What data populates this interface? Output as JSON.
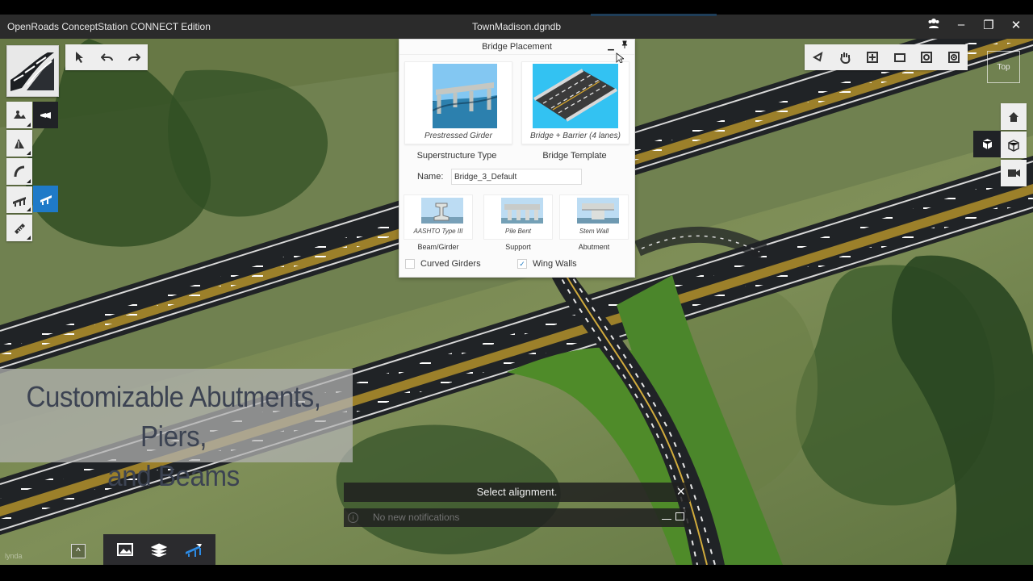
{
  "window": {
    "app_title": "OpenRoads ConceptStation CONNECT Edition",
    "file_title": "TownMadison.dgndb",
    "controls": {
      "user_icon": "users-icon",
      "minimize": "–",
      "restore": "❐",
      "close": "✕"
    }
  },
  "toolbar": {
    "icons": [
      "select-icon",
      "undo-icon",
      "redo-icon"
    ]
  },
  "left_tools": {
    "icons": [
      "terrain-icon",
      "alignment-icon",
      "curve-icon",
      "bridge-icon",
      "ruler-icon"
    ]
  },
  "right_tools": {
    "icons": [
      "fit-view-icon",
      "pan-icon",
      "zoom-window-icon",
      "window-icon",
      "camera-settings-icon",
      "camera-view-icon"
    ]
  },
  "view": {
    "cube_label": "Top"
  },
  "bridge_panel": {
    "title": "Bridge Placement",
    "superstructure_caption": "Prestressed Girder",
    "template_caption": "Bridge + Barrier (4 lanes)",
    "superstructure_label": "Superstructure Type",
    "template_label": "Bridge Template",
    "name_label": "Name:",
    "name_value": "Bridge_3_Default",
    "beam_caption": "AASHTO Type III",
    "beam_label": "Beam/Girder",
    "support_caption": "Pile Bent",
    "support_label": "Support",
    "abutment_caption": "Stem Wall",
    "abutment_label": "Abutment",
    "curved_girders_label": "Curved Girders",
    "wing_walls_label": "Wing Walls",
    "wing_walls_checked": true,
    "curved_girders_checked": false
  },
  "lower_third": {
    "line1": "Customizable Abutments, Piers,",
    "line2": "and Beams"
  },
  "message": {
    "prompt": "Select alignment.",
    "notifications": "No new notifications"
  },
  "watermark": "lynda",
  "colors": {
    "title_bar": "#2b2b2b",
    "panel_accent": "#237bc2",
    "road": "#202326",
    "lane_stripe": "#f4f4f4",
    "center_stripe": "#c69b2d",
    "grass": "#4d7d2d"
  }
}
